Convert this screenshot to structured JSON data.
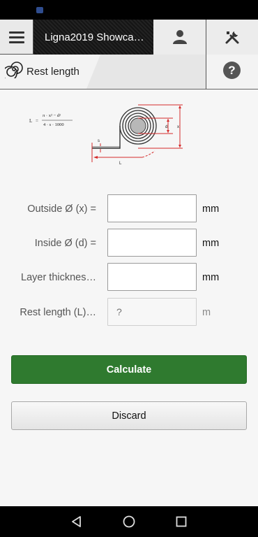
{
  "app": {
    "title": "Ligna2019 Showca…"
  },
  "header": {
    "section_title": "Rest length",
    "help_label": "?"
  },
  "formula": {
    "lhs": "L",
    "numerator": "π · x² − d²",
    "denominator": "4 · s · 1000"
  },
  "diagram_labels": {
    "d": "d",
    "x": "x",
    "s": "s",
    "L": "L"
  },
  "form": {
    "fields": [
      {
        "label": "Outside Ø (x) =",
        "value": "",
        "placeholder": "",
        "unit": "mm"
      },
      {
        "label": "Inside Ø (d) =",
        "value": "",
        "placeholder": "",
        "unit": "mm"
      },
      {
        "label": "Layer thicknes…",
        "value": "",
        "placeholder": "",
        "unit": "mm"
      },
      {
        "label": "Rest length (L)…",
        "value": "",
        "placeholder": "?",
        "unit": "m"
      }
    ]
  },
  "buttons": {
    "calculate": "Calculate",
    "discard": "Discard"
  },
  "colors": {
    "accent_green": "#2f7a2f",
    "topbar_dark": "#1b1b1b",
    "diagram_red": "#d42a2a"
  },
  "icons": {
    "menu": "hamburger-icon",
    "user": "user-icon",
    "tools": "tools-icon",
    "section": "spiral-icon",
    "help": "help-icon",
    "nav_back": "back-triangle-icon",
    "nav_home": "home-circle-icon",
    "nav_recent": "recent-square-icon"
  }
}
